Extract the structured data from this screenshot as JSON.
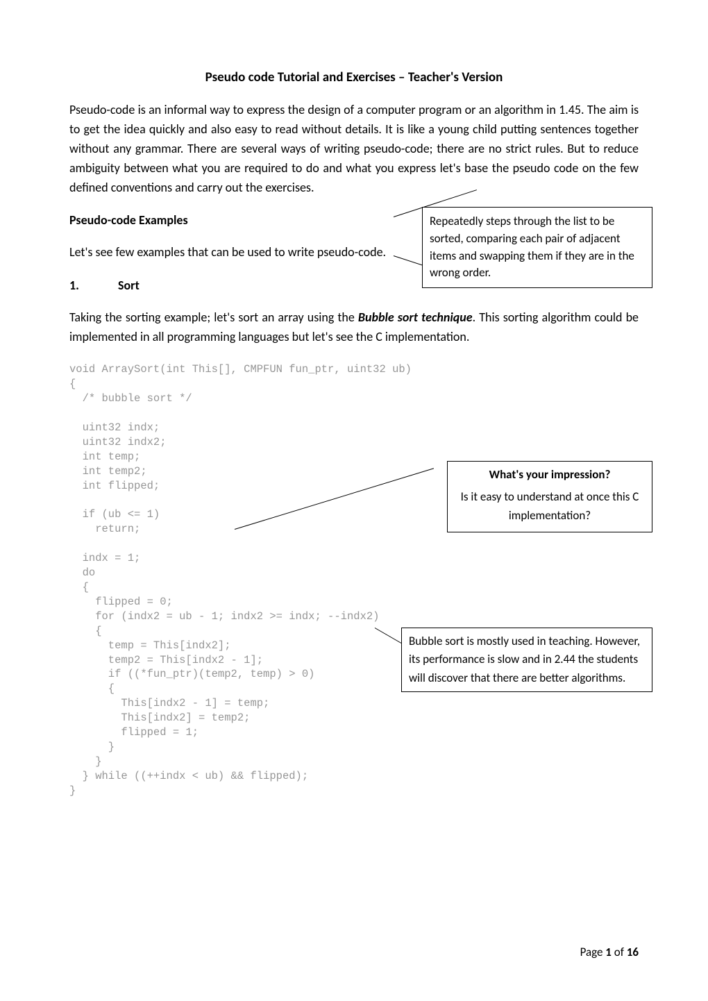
{
  "title": "Pseudo code Tutorial and Exercises – Teacher's Version",
  "intro": "Pseudo-code is an informal way to express the design of a computer program or an algorithm in 1.45. The aim is to get the idea quickly and also easy to read without details. It is like a young child putting sentences together without any grammar. There are several ways of writing pseudo-code; there are no strict rules. But to reduce ambiguity between what you are required to do and what you express let's base the pseudo code on the few defined conventions and carry out the exercises.",
  "examples_head": "Pseudo-code Examples",
  "examples_line": "Let's see few examples that can be used to write pseudo-code.",
  "section_num": "1.",
  "section_label": "Sort",
  "callout_repeat": "Repeatedly steps through the list to be sorted, comparing each pair of adjacent items and swapping them if they are in the wrong order.",
  "sort_para_pre": "Taking the sorting example; let's sort an array using the ",
  "sort_para_bi": "Bubble sort technique",
  "sort_para_post": ". This sorting algorithm could be implemented in all programming languages but let's see the C implementation.",
  "code_text": "void ArraySort(int This[], CMPFUN fun_ptr, uint32 ub)\n{\n  /* bubble sort */\n\n  uint32 indx;\n  uint32 indx2;\n  int temp;\n  int temp2;\n  int flipped;\n\n  if (ub <= 1)\n    return;\n\n  indx = 1;\n  do\n  {\n    flipped = 0;\n    for (indx2 = ub - 1; indx2 >= indx; --indx2)\n    {\n      temp = This[indx2];\n      temp2 = This[indx2 - 1];\n      if ((*fun_ptr)(temp2, temp) > 0)\n      {\n        This[indx2 - 1] = temp;\n        This[indx2] = temp2;\n        flipped = 1;\n      }\n    }\n  } while ((++indx < ub) && flipped);\n}",
  "impression_head": "What's your impression?",
  "impression_body": "Is it easy to understand at once this C implementation?",
  "bubble_note": "Bubble sort is mostly used in teaching. However, its performance is slow and in 2.44 the students will discover that there are better algorithms.",
  "footer_pre": "Page ",
  "footer_pg": "1",
  "footer_mid": " of ",
  "footer_total": "16"
}
